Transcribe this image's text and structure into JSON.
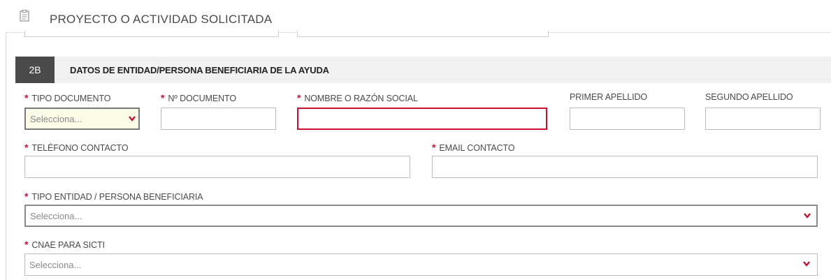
{
  "header": {
    "title": "PROYECTO O ACTIVIDAD SOLICITADA",
    "icon": "clipboard-icon"
  },
  "section": {
    "number": "2B",
    "title": "DATOS DE ENTIDAD/PERSONA BENEFICIARIA DE LA AYUDA"
  },
  "fields": {
    "tipo_documento": {
      "label": "TIPO DOCUMENTO",
      "placeholder": "Selecciona..."
    },
    "n_documento": {
      "label": "Nº DOCUMENTO",
      "value": ""
    },
    "nombre": {
      "label": "NOMBRE O RAZÓN SOCIAL",
      "value": ""
    },
    "primer_apellido": {
      "label": "PRIMER APELLIDO",
      "value": ""
    },
    "segundo_apellido": {
      "label": "SEGUNDO APELLIDO",
      "value": ""
    },
    "telefono": {
      "label": "TELÉFONO CONTACTO",
      "value": ""
    },
    "email": {
      "label": "EMAIL CONTACTO",
      "value": ""
    },
    "tipo_entidad": {
      "label": "TIPO ENTIDAD / PERSONA BENEFICIARIA",
      "placeholder": "Selecciona..."
    },
    "cnae": {
      "label": "CNAE PARA SICTI",
      "placeholder": "Selecciona..."
    }
  },
  "colors": {
    "required": "#d0103a",
    "error_border": "#c8102e",
    "section_badge": "#4a4a4a",
    "chevron": "#c8102e"
  }
}
